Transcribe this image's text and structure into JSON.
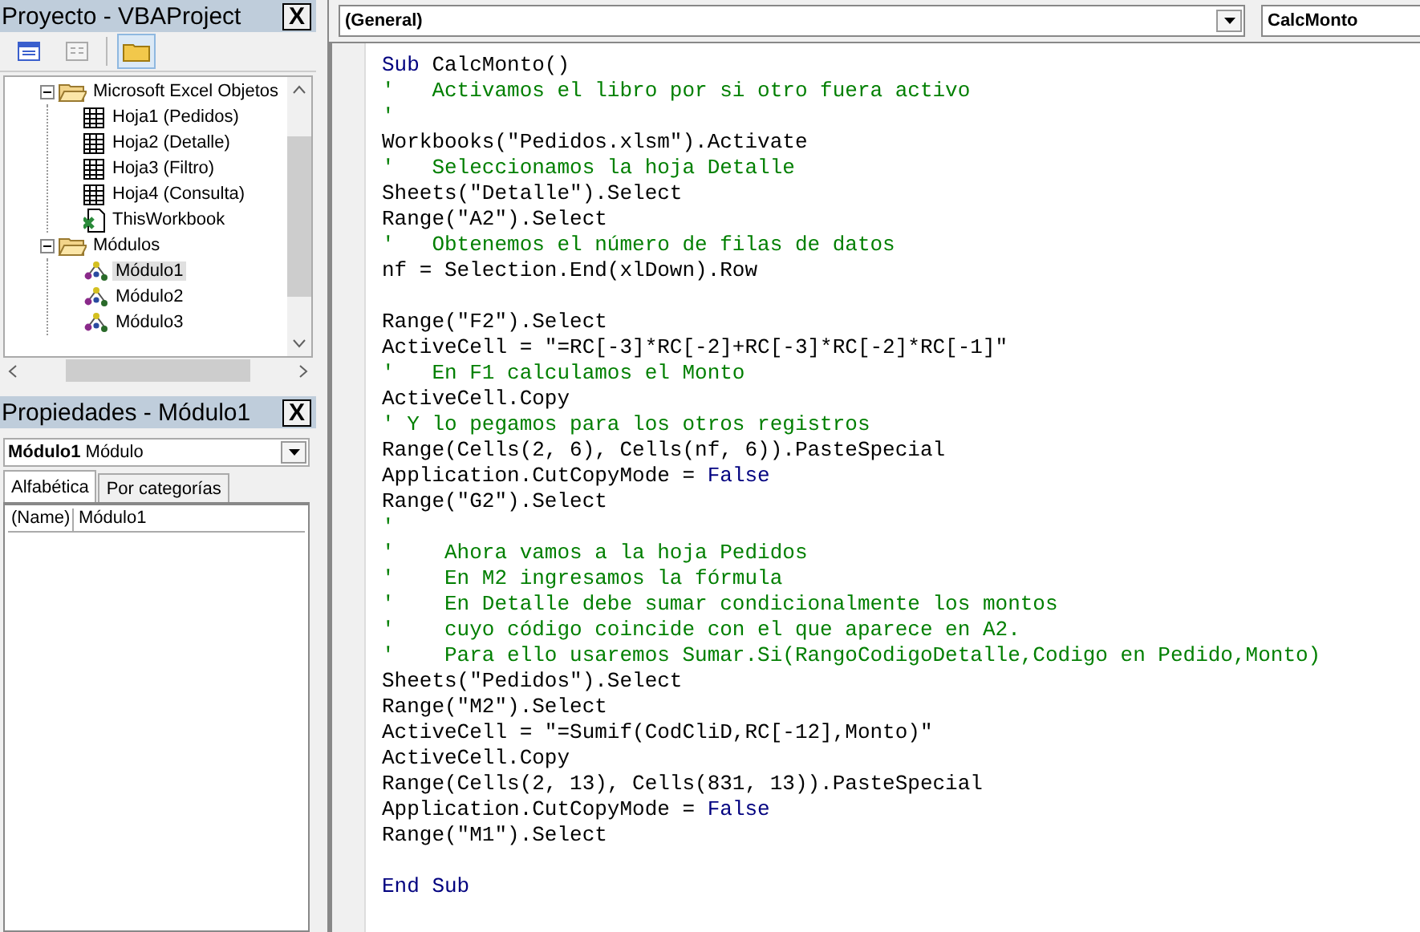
{
  "project": {
    "title": "Proyecto - VBAProject",
    "close": "X",
    "tree": [
      {
        "label": "Microsoft Excel Objetos",
        "kind": "folder",
        "expanded": true,
        "selected": false,
        "children": [
          {
            "label": "Hoja1 (Pedidos)",
            "kind": "sheet",
            "selected": false
          },
          {
            "label": "Hoja2 (Detalle)",
            "kind": "sheet",
            "selected": false
          },
          {
            "label": "Hoja3 (Filtro)",
            "kind": "sheet",
            "selected": false
          },
          {
            "label": "Hoja4 (Consulta)",
            "kind": "sheet",
            "selected": false
          },
          {
            "label": "ThisWorkbook",
            "kind": "workbook",
            "selected": false
          }
        ]
      },
      {
        "label": "Módulos",
        "kind": "folder",
        "expanded": true,
        "selected": false,
        "children": [
          {
            "label": "Módulo1",
            "kind": "module",
            "selected": true
          },
          {
            "label": "Módulo2",
            "kind": "module",
            "selected": false
          },
          {
            "label": "Módulo3",
            "kind": "module",
            "selected": false
          }
        ]
      }
    ]
  },
  "properties": {
    "title": "Propiedades - Módulo1",
    "close": "X",
    "object_name": "Módulo1",
    "object_type": "Módulo",
    "tabs": [
      {
        "label": "Alfabética",
        "selected": true
      },
      {
        "label": "Por categorías",
        "selected": false
      }
    ],
    "rows": [
      {
        "name": "(Name)",
        "value": "Módulo1"
      }
    ]
  },
  "code": {
    "object_combo": "(General)",
    "procedure_combo": "CalcMonto",
    "lines": [
      {
        "kind": "code",
        "segments": [
          {
            "kind": "keyword",
            "text": "Sub"
          },
          {
            "kind": "plain",
            "text": " CalcMonto()"
          }
        ]
      },
      {
        "kind": "code",
        "segments": [
          {
            "kind": "comment",
            "text": "'   Activamos el libro por si otro fuera activo"
          }
        ]
      },
      {
        "kind": "code",
        "segments": [
          {
            "kind": "comment",
            "text": "'"
          }
        ]
      },
      {
        "kind": "code",
        "segments": [
          {
            "kind": "plain",
            "text": "Workbooks(\"Pedidos.xlsm\").Activate"
          }
        ]
      },
      {
        "kind": "code",
        "segments": [
          {
            "kind": "comment",
            "text": "'   Seleccionamos la hoja Detalle"
          }
        ]
      },
      {
        "kind": "code",
        "segments": [
          {
            "kind": "plain",
            "text": "Sheets(\"Detalle\").Select"
          }
        ]
      },
      {
        "kind": "code",
        "segments": [
          {
            "kind": "plain",
            "text": "Range(\"A2\").Select"
          }
        ]
      },
      {
        "kind": "code",
        "segments": [
          {
            "kind": "comment",
            "text": "'   Obtenemos el número de filas de datos"
          }
        ]
      },
      {
        "kind": "code",
        "segments": [
          {
            "kind": "plain",
            "text": "nf = Selection.End(xlDown).Row"
          }
        ]
      },
      {
        "kind": "blank"
      },
      {
        "kind": "code",
        "segments": [
          {
            "kind": "plain",
            "text": "Range(\"F2\").Select"
          }
        ]
      },
      {
        "kind": "code",
        "segments": [
          {
            "kind": "plain",
            "text": "ActiveCell = \"=RC[-3]*RC[-2]+RC[-3]*RC[-2]*RC[-1]\""
          }
        ]
      },
      {
        "kind": "code",
        "segments": [
          {
            "kind": "comment",
            "text": "'   En F1 calculamos el Monto"
          }
        ]
      },
      {
        "kind": "code",
        "segments": [
          {
            "kind": "plain",
            "text": "ActiveCell.Copy"
          }
        ]
      },
      {
        "kind": "code",
        "segments": [
          {
            "kind": "comment",
            "text": "' Y lo pegamos para los otros registros"
          }
        ]
      },
      {
        "kind": "code",
        "segments": [
          {
            "kind": "plain",
            "text": "Range(Cells(2, 6), Cells(nf, 6)).PasteSpecial"
          }
        ]
      },
      {
        "kind": "code",
        "segments": [
          {
            "kind": "plain",
            "text": "Application.CutCopyMode = "
          },
          {
            "kind": "keyword",
            "text": "False"
          }
        ]
      },
      {
        "kind": "code",
        "segments": [
          {
            "kind": "plain",
            "text": "Range(\"G2\").Select"
          }
        ]
      },
      {
        "kind": "code",
        "segments": [
          {
            "kind": "comment",
            "text": "'"
          }
        ]
      },
      {
        "kind": "code",
        "segments": [
          {
            "kind": "comment",
            "text": "'    Ahora vamos a la hoja Pedidos"
          }
        ]
      },
      {
        "kind": "code",
        "segments": [
          {
            "kind": "comment",
            "text": "'    En M2 ingresamos la fórmula"
          }
        ]
      },
      {
        "kind": "code",
        "segments": [
          {
            "kind": "comment",
            "text": "'    En Detalle debe sumar condicionalmente los montos"
          }
        ]
      },
      {
        "kind": "code",
        "segments": [
          {
            "kind": "comment",
            "text": "'    cuyo código coincide con el que aparece en A2."
          }
        ]
      },
      {
        "kind": "code",
        "segments": [
          {
            "kind": "comment",
            "text": "'    Para ello usaremos Sumar.Si(RangoCodigoDetalle,Codigo en Pedido,Monto)"
          }
        ]
      },
      {
        "kind": "code",
        "segments": [
          {
            "kind": "plain",
            "text": "Sheets(\"Pedidos\").Select"
          }
        ]
      },
      {
        "kind": "code",
        "segments": [
          {
            "kind": "plain",
            "text": "Range(\"M2\").Select"
          }
        ]
      },
      {
        "kind": "code",
        "segments": [
          {
            "kind": "plain",
            "text": "ActiveCell = \"=Sumif(CodCliD,RC[-12],Monto)\""
          }
        ]
      },
      {
        "kind": "code",
        "segments": [
          {
            "kind": "plain",
            "text": "ActiveCell.Copy"
          }
        ]
      },
      {
        "kind": "code",
        "segments": [
          {
            "kind": "plain",
            "text": "Range(Cells(2, 13), Cells(831, 13)).PasteSpecial"
          }
        ]
      },
      {
        "kind": "code",
        "segments": [
          {
            "kind": "plain",
            "text": "Application.CutCopyMode = "
          },
          {
            "kind": "keyword",
            "text": "False"
          }
        ]
      },
      {
        "kind": "code",
        "segments": [
          {
            "kind": "plain",
            "text": "Range(\"M1\").Select"
          }
        ]
      },
      {
        "kind": "blank"
      },
      {
        "kind": "code",
        "segments": [
          {
            "kind": "keyword",
            "text": "End Sub"
          }
        ]
      }
    ]
  }
}
